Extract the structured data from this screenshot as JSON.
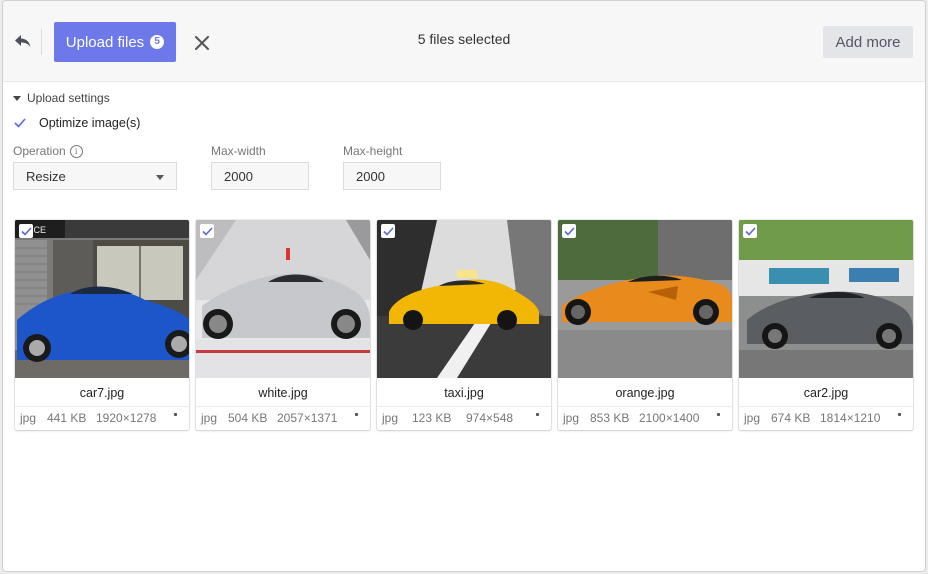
{
  "header": {
    "upload_label": "Upload files",
    "upload_count": "5",
    "files_selected": "5 files selected",
    "add_more_label": "Add more"
  },
  "settings": {
    "toggle_label": "Upload settings",
    "optimize_label": "Optimize image(s)",
    "optimize_checked": true,
    "operation_label": "Operation",
    "operation_value": "Resize",
    "max_width_label": "Max-width",
    "max_width_value": "2000",
    "max_height_label": "Max-height",
    "max_height_value": "2000"
  },
  "files": [
    {
      "name": "car7.jpg",
      "type": "jpg",
      "size": "441 KB",
      "dims": "1920×1278",
      "thumb_color": "blue",
      "sign_text": "NCE"
    },
    {
      "name": "white.jpg",
      "type": "jpg",
      "size": "504 KB",
      "dims": "2057×1371",
      "thumb_color": "silver"
    },
    {
      "name": "taxi.jpg",
      "type": "jpg",
      "size": "123 KB",
      "dims": "974×548",
      "thumb_color": "yellow"
    },
    {
      "name": "orange.jpg",
      "type": "jpg",
      "size": "853 KB",
      "dims": "2100×1400",
      "thumb_color": "orange"
    },
    {
      "name": "car2.jpg",
      "type": "jpg",
      "size": "674 KB",
      "dims": "1814×1210",
      "thumb_color": "grey"
    }
  ],
  "colors": {
    "accent": "#6d79e8",
    "check": "#5b67d6"
  }
}
